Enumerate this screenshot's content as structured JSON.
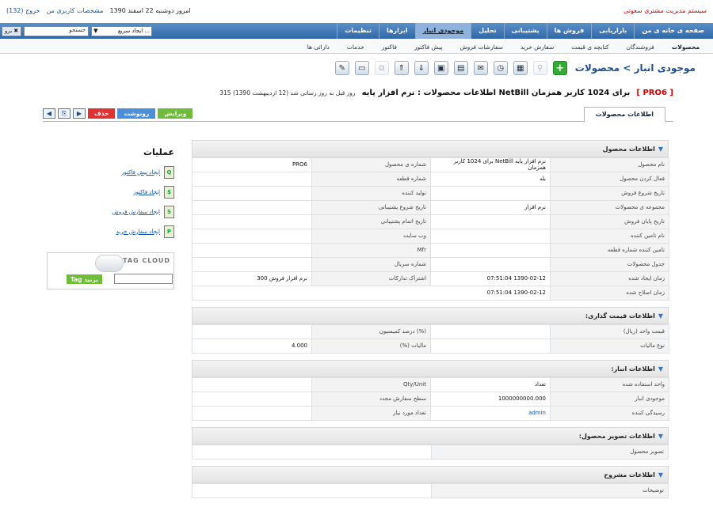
{
  "header": {
    "brand": "سیستم مدیریت مشتری سعوتی",
    "date": "امروز دوشنبه 22 اسفند 1390",
    "profile_link": "مشخصات کاربری من",
    "logout_link": "خروج (132)"
  },
  "nav": {
    "items": [
      "صفحه ی خانه ی من",
      "بازاریابی",
      "فروش ها",
      "پشتیبانی",
      "تحلیل",
      "موجودی انبار",
      "ابزارها",
      "تنظیمات"
    ],
    "quick_create": "ایجاد سریع ...",
    "search_placeholder": "جستجو",
    "search_value": "جستجو",
    "go_label": "برو"
  },
  "subnav": [
    "محصولات",
    "فروشندگان",
    "کتابچه ی قیمت",
    "سفارش خرید",
    "سفارشات فروش",
    "پیش فاکتور",
    "فاکتور",
    "خدمات",
    "دارائی ها"
  ],
  "page_title": "موجودی انبار > محصولات",
  "toolbar_icons": [
    "plus-icon",
    "search-icon",
    "calendar-icon",
    "clock-icon",
    "chat-icon",
    "calculator-icon",
    "document-icon",
    "import-icon",
    "export-icon",
    "find-duplicates-icon",
    "screen-icon",
    "settings-icon"
  ],
  "record": {
    "id": "[ PRO6 ]",
    "title": "اطلاعات محصولات : نرم افزار پایه NetBill برای 1024 کاربر همزمان",
    "updated_note": "315 روز قبل به روز رسانی شد (12 اردیبهشت 1390)"
  },
  "tab_label": "اطلاعات محصولات",
  "buttons": {
    "edit": "ویرایش",
    "duplicate": "رونوشت",
    "delete": "حذف"
  },
  "sidebar": {
    "title": "عملیات",
    "ops": [
      "ایجاد پیش فاکتور",
      "ایجاد فاکتور",
      "ایجاد سفارش فروش",
      "ایجاد سفارش خرید"
    ]
  },
  "tagcloud": {
    "title": "TAG CLOUD",
    "button": "Tag بزنید"
  },
  "sections": {
    "product": {
      "title": "اطلاعات محصول",
      "rows": [
        [
          "نام محصول",
          "نرم افزار پایه NetBill برای 1024 کاربر همزمان",
          "شماره ی محصول",
          "PRO6"
        ],
        [
          "فعال کردن محصول",
          "بله",
          "شماره قطعه",
          ""
        ],
        [
          "تاریخ شروع فروش",
          "",
          "تولید کننده",
          ""
        ],
        [
          "مجموعه ی محصولات",
          "نرم افزار",
          "تاریخ شروع پشتیبانی",
          ""
        ],
        [
          "تاریخ پایان فروش",
          "",
          "تاریخ اتمام پشتیبانی",
          ""
        ],
        [
          "نام تامین کننده",
          "",
          "وب سایت",
          ""
        ],
        [
          "تامین کننده شماره قطعه",
          "",
          "Mfr",
          ""
        ],
        [
          "جدول محصولات",
          "",
          "شماره سریال",
          ""
        ],
        [
          "زمان ایجاد شده",
          "1390-02-12 07:51:04",
          "اشتراک تدارکات",
          "نرم افزار فروش 300"
        ],
        [
          "زمان اصلاح شده",
          "1390-02-12 07:51:04"
        ]
      ]
    },
    "pricing": {
      "title": ":اطلاعات قیمت گذاری",
      "rows": [
        [
          "قیمت واحد (ریال)",
          "",
          "(%) درصد کمیسیون",
          ""
        ],
        [
          "نوع مالیات",
          "",
          "مالیات (%)",
          "4.000"
        ]
      ]
    },
    "stock": {
      "title": ":اطلاعات انبار",
      "rows": [
        [
          "واحد استفاده شده",
          "تعداد",
          "Qty/Unit",
          ""
        ],
        [
          "موجودی انبار",
          "1000000000.000",
          "سطح سفارش مجدد",
          ""
        ],
        [
          "رسیدگی کننده",
          "admin",
          "تعداد مورد نیاز",
          ""
        ]
      ]
    },
    "image": {
      "title": ":اطلاعات تصویر محصول",
      "rows": [
        [
          "تصویر محصول",
          ""
        ]
      ]
    },
    "desc": {
      "title": "اطلاعات مشروح",
      "rows": [
        [
          "توضیحات",
          ""
        ]
      ]
    }
  }
}
